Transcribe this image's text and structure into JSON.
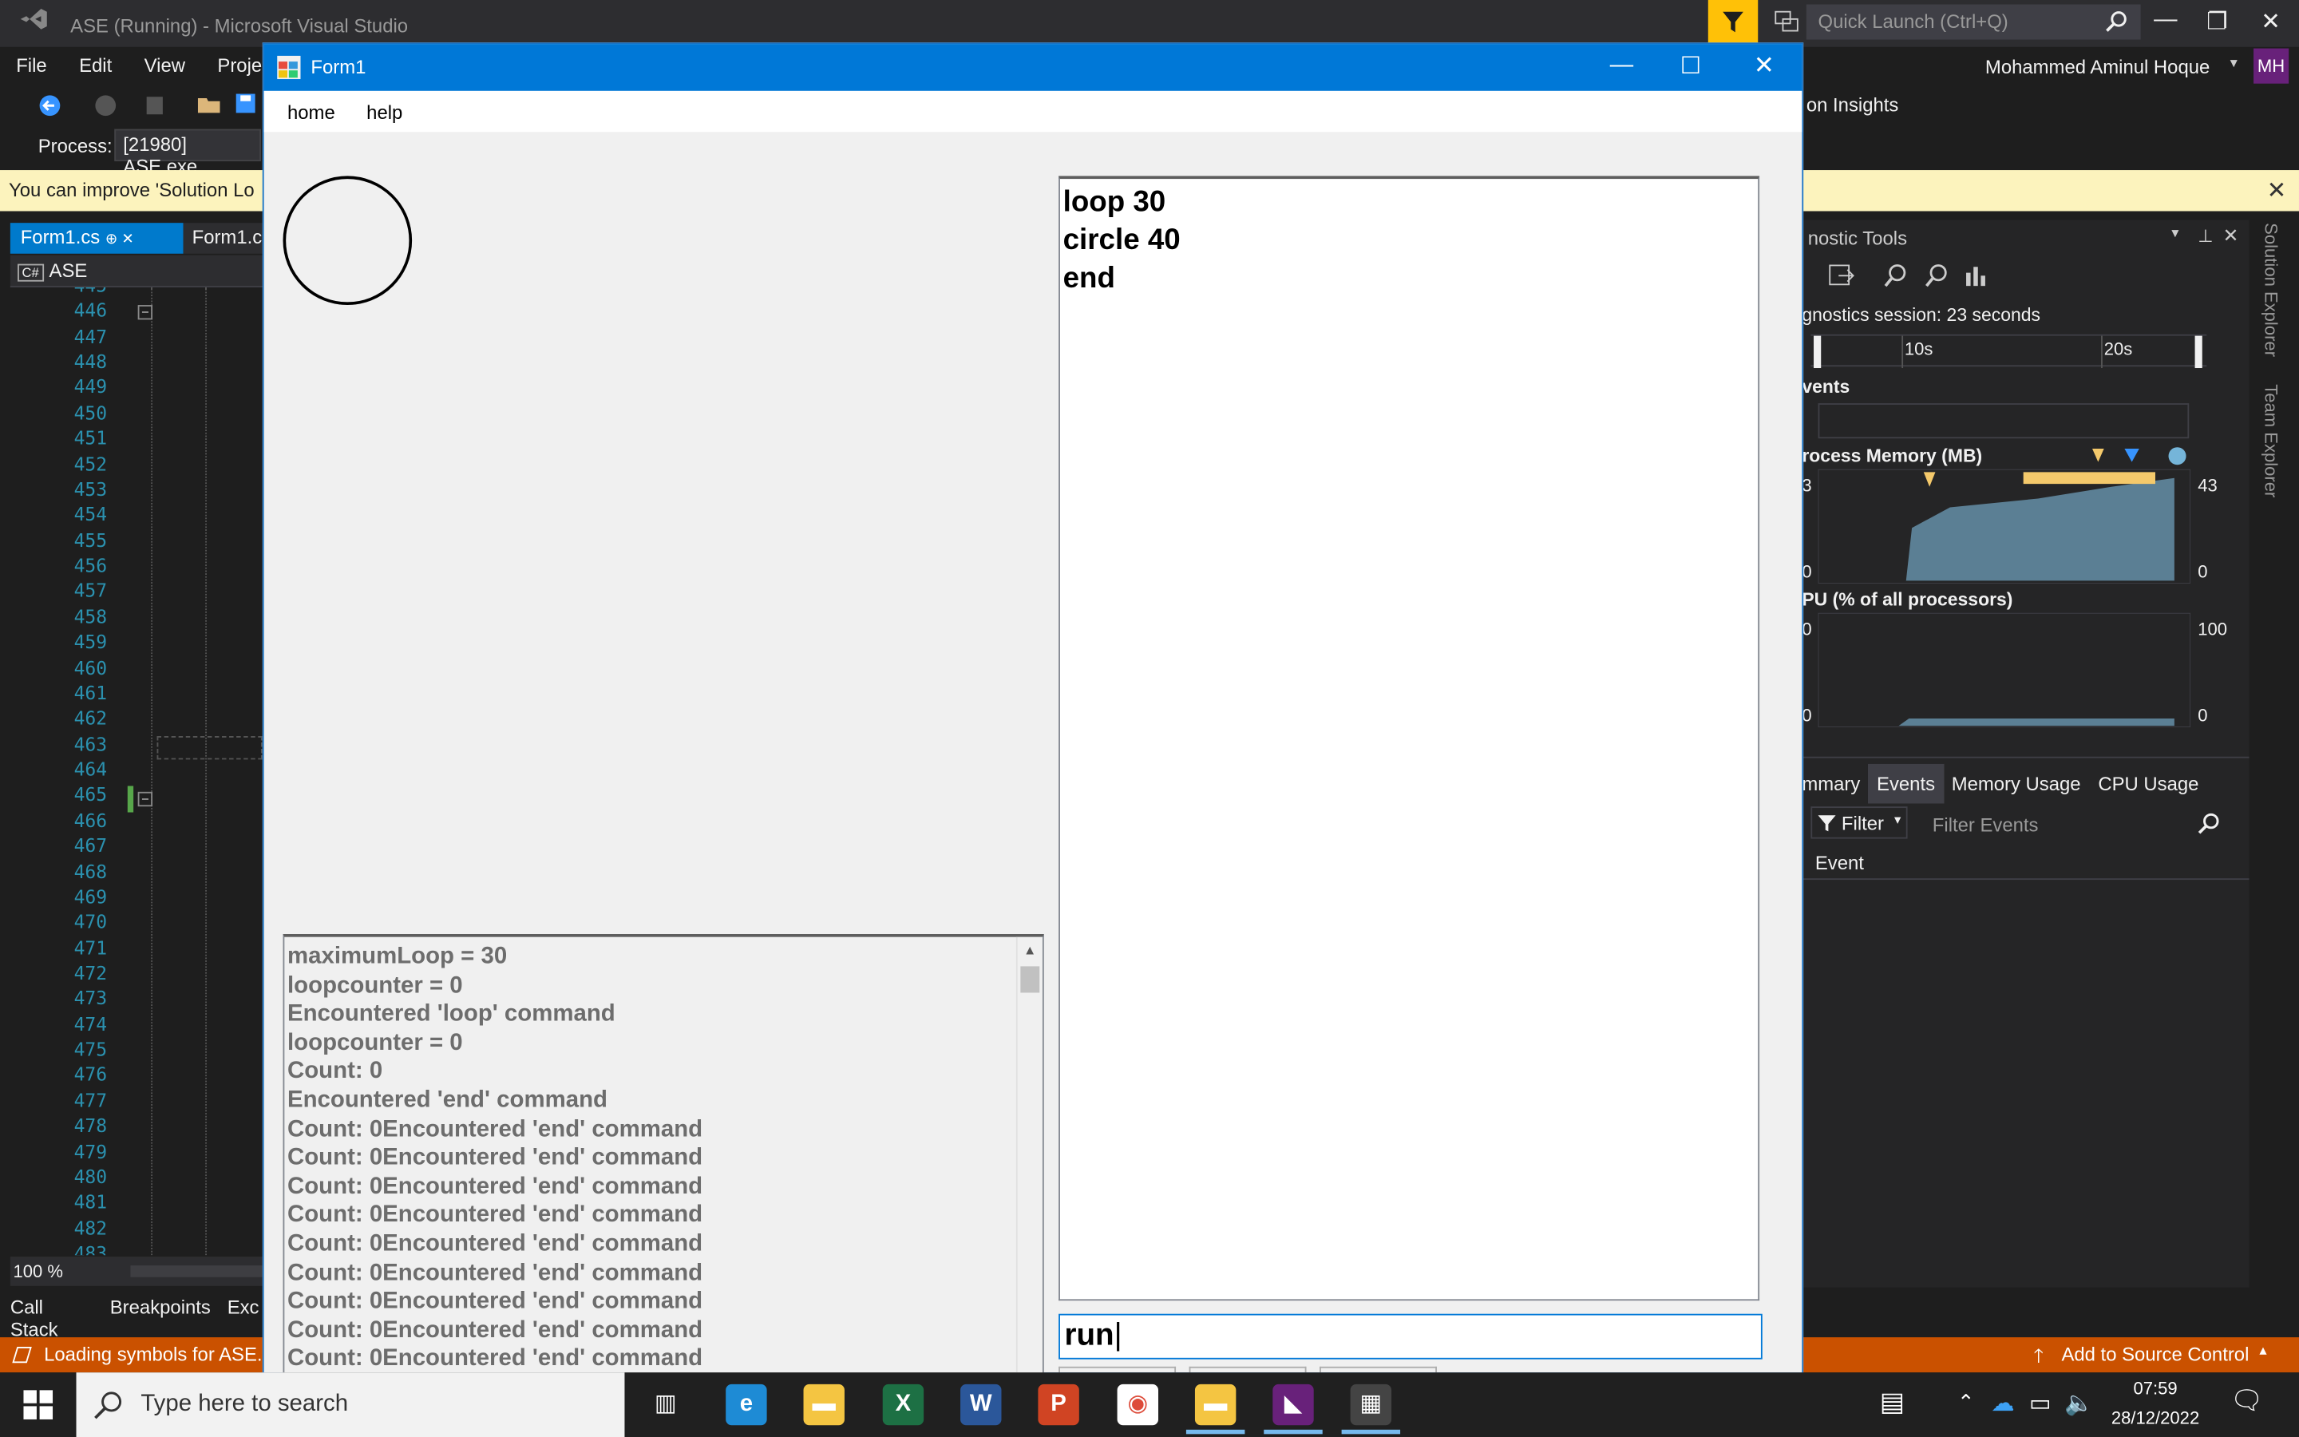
{
  "vs": {
    "title": "ASE (Running) - Microsoft Visual Studio",
    "quick_launch": "Quick Launch (Ctrl+Q)",
    "menu": [
      "File",
      "Edit",
      "View",
      "Projec"
    ],
    "user": "Mohammed Aminul Hoque",
    "avatar": "MH",
    "process_label": "Process:",
    "process_value": "[21980] ASE.exe",
    "infobar_text": "You can improve 'Solution Lo",
    "infobar_close": "✕",
    "insights": "on Insights",
    "tab_active": "Form1.cs",
    "tab_other": "Form1.c",
    "nav_project": "ASE",
    "line_numbers": [
      "445",
      "446",
      "447",
      "448",
      "449",
      "450",
      "451",
      "452",
      "453",
      "454",
      "455",
      "456",
      "457",
      "458",
      "459",
      "460",
      "461",
      "462",
      "463",
      "464",
      "465",
      "466",
      "467",
      "468",
      "469",
      "470",
      "471",
      "472",
      "473",
      "474",
      "475",
      "476",
      "477",
      "478",
      "479",
      "480",
      "481",
      "482",
      "483"
    ],
    "zoom": "100 %",
    "bottom_tabs": [
      "Call Stack",
      "Breakpoints",
      "Exc"
    ],
    "status_left": "Loading symbols for ASE.",
    "status_right": "Add to Source Control",
    "colors": {
      "accent": "#007acc",
      "status": "#ca5100",
      "filter": "#ffc107"
    }
  },
  "diag": {
    "title": "nostic Tools",
    "session": "gnostics session: 23 seconds",
    "tick_10": "10s",
    "tick_20": "20s",
    "events_label": "vents",
    "memory_label": "rocess Memory (MB)",
    "mem_max_left": "3",
    "mem_max_right": "43",
    "mem_min_left": "0",
    "mem_min_right": "0",
    "cpu_label": "PU (% of all processors)",
    "cpu_max_left": "0",
    "cpu_max_right": "100",
    "cpu_min_left": "0",
    "cpu_min_right": "0",
    "tabs": [
      "mmary",
      "Events",
      "Memory Usage",
      "CPU Usage"
    ],
    "filter": "Filter",
    "filter_placeholder": "Filter Events",
    "col_event": "Event",
    "side_tabs": [
      "Solution Explorer",
      "Team Explorer"
    ]
  },
  "form": {
    "title": "Form1",
    "menu": [
      "home",
      "help"
    ],
    "program_text": "loop 30\ncircle 40\nend",
    "command_value": "run",
    "output_lines": [
      "maximumLoop = 30",
      "loopcounter = 0",
      "Encountered 'loop' command",
      "loopcounter = 0",
      "Count: 0",
      "Encountered 'end' command",
      "Count: 0Encountered 'end' command",
      "Count: 0Encountered 'end' command",
      "Count: 0Encountered 'end' command",
      "Count: 0Encountered 'end' command",
      "Count: 0Encountered 'end' command",
      "Count: 0Encountered 'end' command",
      "Count: 0Encountered 'end' command",
      "Count: 0Encountered 'end' command",
      "Count: 0Encountered 'end' command"
    ]
  },
  "taskbar": {
    "search_placeholder": "Type here to search",
    "time": "07:59",
    "date": "28/12/2022",
    "apps": [
      "task-view-icon",
      "edge-icon",
      "file-explorer-icon",
      "excel-icon",
      "word-icon",
      "powerpoint-icon",
      "chrome-icon",
      "folder-icon",
      "visual-studio-icon",
      "form-app-icon"
    ]
  }
}
